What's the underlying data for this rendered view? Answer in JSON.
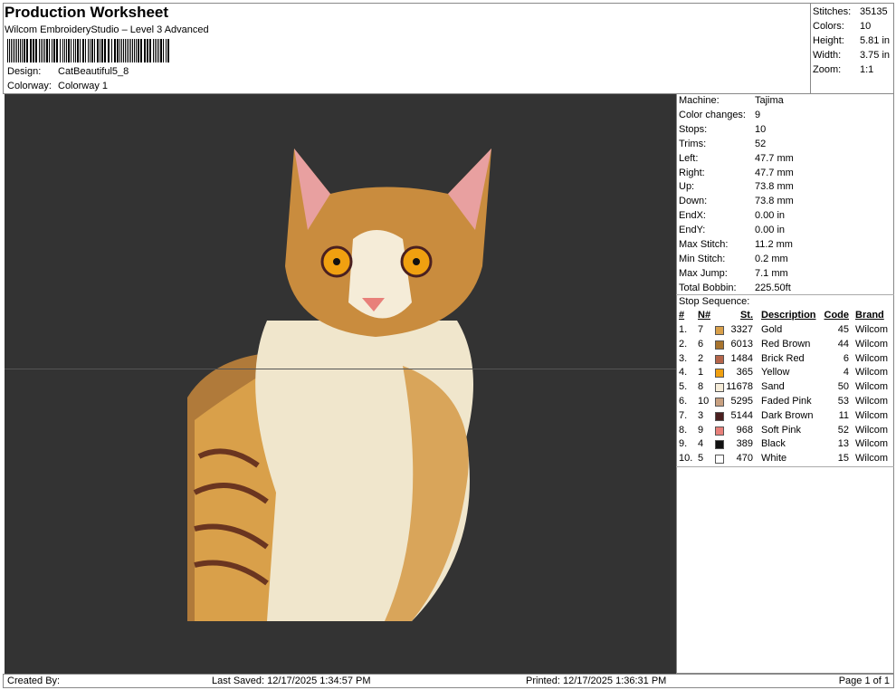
{
  "header": {
    "title": "Production Worksheet",
    "subtitle": "Wilcom EmbroideryStudio – Level 3 Advanced",
    "design_label": "Design:",
    "design_value": "CatBeautiful5_8",
    "colorway_label": "Colorway:",
    "colorway_value": "Colorway 1"
  },
  "stats": [
    {
      "label": "Stitches:",
      "value": "35135"
    },
    {
      "label": "Colors:",
      "value": "10"
    },
    {
      "label": "Height:",
      "value": "5.81 in"
    },
    {
      "label": "Width:",
      "value": "3.75 in"
    },
    {
      "label": "Zoom:",
      "value": "1:1"
    }
  ],
  "machine": [
    {
      "label": "Machine:",
      "value": "Tajima"
    },
    {
      "label": "Color changes:",
      "value": "9"
    },
    {
      "label": "Stops:",
      "value": "10"
    },
    {
      "label": "Trims:",
      "value": "52"
    },
    {
      "label": "Left:",
      "value": "47.7 mm"
    },
    {
      "label": "Right:",
      "value": "47.7 mm"
    },
    {
      "label": "Up:",
      "value": "73.8 mm"
    },
    {
      "label": "Down:",
      "value": "73.8 mm"
    },
    {
      "label": "EndX:",
      "value": "0.00 in"
    },
    {
      "label": "EndY:",
      "value": "0.00 in"
    },
    {
      "label": "Max Stitch:",
      "value": "11.2 mm"
    },
    {
      "label": "Min Stitch:",
      "value": "0.2 mm"
    },
    {
      "label": "Max Jump:",
      "value": "7.1 mm"
    },
    {
      "label": "Total Bobbin:",
      "value": "225.50ft"
    }
  ],
  "stop_sequence": {
    "label": "Stop Sequence:",
    "headers": [
      "#",
      "N#",
      "St.",
      "Description",
      "Code",
      "Brand"
    ],
    "rows": [
      {
        "n": "1.",
        "needle": "7",
        "color": "#d9a04a",
        "st": "3327",
        "desc": "Gold",
        "code": "45",
        "brand": "Wilcom"
      },
      {
        "n": "2.",
        "needle": "6",
        "color": "#a8742e",
        "st": "6013",
        "desc": "Red Brown",
        "code": "44",
        "brand": "Wilcom"
      },
      {
        "n": "3.",
        "needle": "2",
        "color": "#b5654a",
        "st": "1484",
        "desc": "Brick Red",
        "code": "6",
        "brand": "Wilcom"
      },
      {
        "n": "4.",
        "needle": "1",
        "color": "#f0a010",
        "st": "365",
        "desc": "Yellow",
        "code": "4",
        "brand": "Wilcom"
      },
      {
        "n": "5.",
        "needle": "8",
        "color": "#f5ecd8",
        "st": "11678",
        "desc": "Sand",
        "code": "50",
        "brand": "Wilcom"
      },
      {
        "n": "6.",
        "needle": "10",
        "color": "#c8a080",
        "st": "5295",
        "desc": "Faded Pink",
        "code": "53",
        "brand": "Wilcom"
      },
      {
        "n": "7.",
        "needle": "3",
        "color": "#4a2020",
        "st": "5144",
        "desc": "Dark Brown",
        "code": "11",
        "brand": "Wilcom"
      },
      {
        "n": "8.",
        "needle": "9",
        "color": "#e8807a",
        "st": "968",
        "desc": "Soft Pink",
        "code": "52",
        "brand": "Wilcom"
      },
      {
        "n": "9.",
        "needle": "4",
        "color": "#111111",
        "st": "389",
        "desc": "Black",
        "code": "13",
        "brand": "Wilcom"
      },
      {
        "n": "10.",
        "needle": "5",
        "color": "#ffffff",
        "st": "470",
        "desc": "White",
        "code": "15",
        "brand": "Wilcom"
      }
    ]
  },
  "footer": {
    "created": "Created By:",
    "saved": "Last Saved: 12/17/2025 1:34:57 PM",
    "printed": "Printed: 12/17/2025 1:36:31 PM",
    "page": "Page 1 of 1"
  },
  "canvas_bg": "#333333"
}
